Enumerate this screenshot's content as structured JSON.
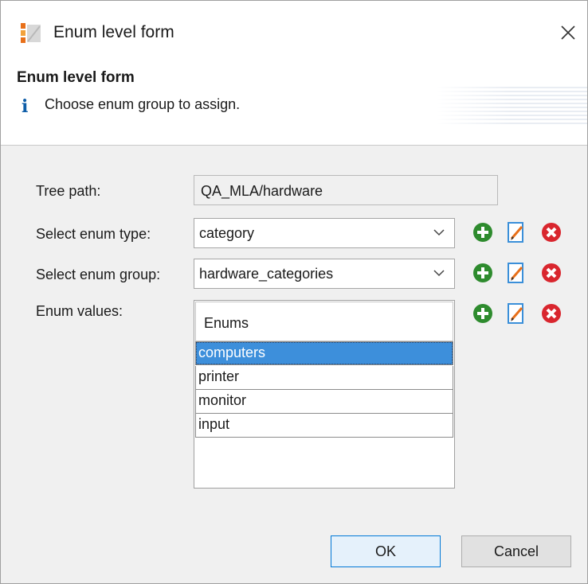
{
  "window": {
    "title": "Enum level form",
    "icon": "form-app-icon",
    "close_icon": "close-icon"
  },
  "banner": {
    "title": "Enum level form",
    "message": "Choose enum group to assign.",
    "info_glyph": "i"
  },
  "form": {
    "tree_path": {
      "label": "Tree path:",
      "value": "QA_MLA/hardware"
    },
    "enum_type": {
      "label": "Select enum type:",
      "value": "category"
    },
    "enum_group": {
      "label": "Select enum group:",
      "value": "hardware_categories"
    },
    "enum_values": {
      "label": "Enum values:",
      "column_header": "Enums",
      "items": [
        "computers",
        "printer",
        "monitor",
        "input"
      ],
      "selected_index": 0
    }
  },
  "action_icons": [
    "add-icon",
    "edit-icon",
    "delete-icon"
  ],
  "colors": {
    "add": "#2e8b2e",
    "edit": "#3a8fd9",
    "delete": "#d9262e",
    "selection": "#3d8fdb",
    "ok_border": "#0078d7"
  },
  "buttons": {
    "ok": "OK",
    "cancel": "Cancel"
  }
}
